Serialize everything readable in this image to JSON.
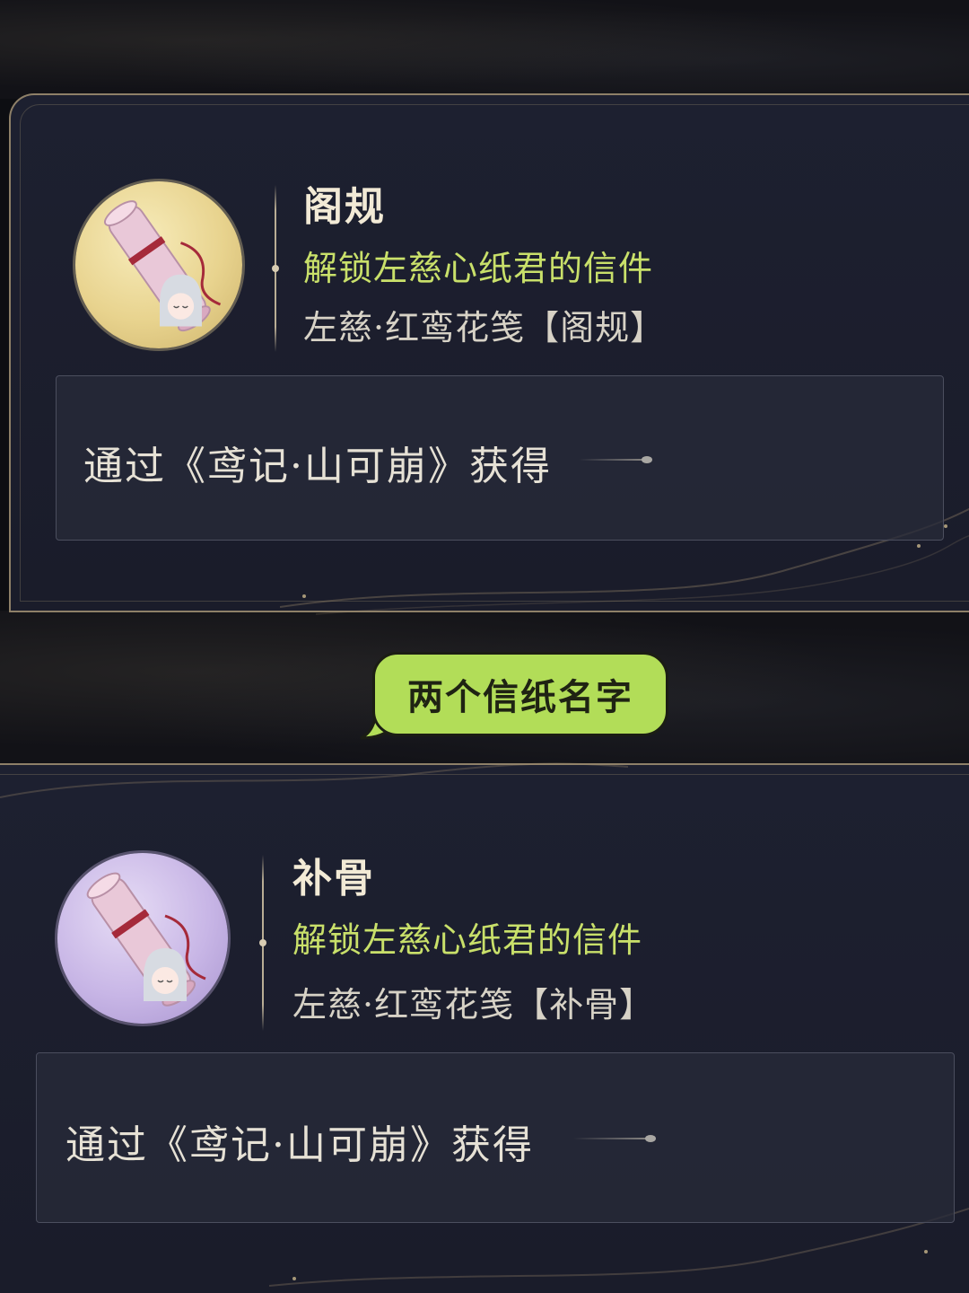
{
  "cards": [
    {
      "title": "阁规",
      "unlock_text": "解锁左慈心纸君的信件",
      "item_name": "左慈·红鸾花笺【阁规】",
      "source_text": "通过《鸢记·山可崩》获得",
      "badge_color": "#e8d38e",
      "icon": "letter-scroll-icon"
    },
    {
      "title": "补骨",
      "unlock_text": "解锁左慈心纸君的信件",
      "item_name": "左慈·红鸾花笺【补骨】",
      "source_text": "通过《鸢记·山可崩》获得",
      "badge_color": "#c8b6e6",
      "icon": "letter-scroll-icon"
    }
  ],
  "caption_bubble": {
    "text": "两个信纸名字",
    "color": "#b2dd58"
  },
  "colors": {
    "unlock_text": "#c9e06a",
    "card_border": "#8e8068",
    "card_bg": "#1d2030"
  }
}
